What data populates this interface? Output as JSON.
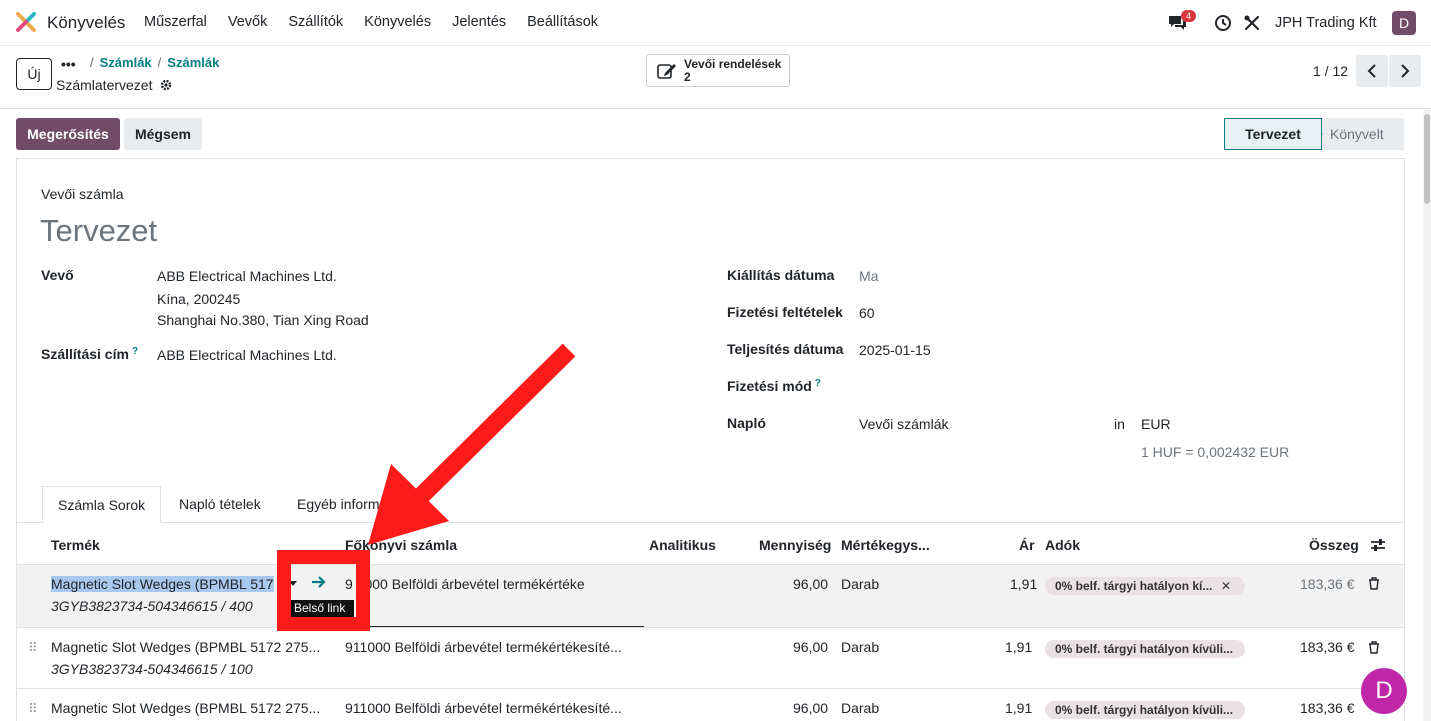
{
  "navbar": {
    "app_name": "Könyvelés",
    "menu": [
      "Műszerfal",
      "Vevők",
      "Szállítók",
      "Könyvelés",
      "Jelentés",
      "Beállítások"
    ],
    "chat_badge": "4",
    "company": "JPH Trading Kft",
    "user_initial": "D"
  },
  "control": {
    "new_label": "Új",
    "breadcrumb": [
      "Számlák",
      "Számlák"
    ],
    "record_title": "Számlatervezet",
    "smart_button": {
      "label": "Vevői rendelések",
      "count": "2"
    },
    "pager": "1 / 12"
  },
  "actions": {
    "confirm": "Megerősítés",
    "cancel": "Mégsem"
  },
  "statusbar": {
    "draft": "Tervezet",
    "posted": "Könyvelt"
  },
  "form": {
    "doc_type": "Vevői számla",
    "doc_name": "Tervezet",
    "customer_label": "Vevő",
    "customer_lines": [
      "ABB Electrical Machines Ltd.",
      "Kína, 200245",
      "Shanghai No.380, Tian Xing Road"
    ],
    "shipping_label": "Szállítási cím",
    "shipping_value": "ABB Electrical Machines Ltd.",
    "invoice_date_label": "Kiállítás dátuma",
    "invoice_date_value": "Ma",
    "payment_terms_label": "Fizetési feltételek",
    "payment_terms_value": "60",
    "delivery_date_label": "Teljesítés dátuma",
    "delivery_date_value": "2025-01-15",
    "payment_method_label": "Fizetési mód",
    "journal_label": "Napló",
    "journal_value": "Vevői számlák",
    "in_label": "in",
    "currency": "EUR",
    "rate": "1 HUF = 0,002432 EUR",
    "help_mark": "?"
  },
  "tabs": [
    "Számla Sorok",
    "Napló tételek",
    "Egyéb inform"
  ],
  "table": {
    "headers": {
      "product": "Termék",
      "account": "Főkönyvi számla",
      "analytic": "Analitikus",
      "quantity": "Mennyiség",
      "uom": "Mértékegys...",
      "price": "Ár",
      "taxes": "Adók",
      "subtotal": "Összeg"
    },
    "rows": [
      {
        "product": "Magnetic Slot Wedges (BPMBL 517",
        "ref": "3GYB3823734-504346615 / 400",
        "account": "9 1000 Belföldi árbevétel termékértéke",
        "quantity": "96,00",
        "uom": "Darab",
        "price": "1,91",
        "tax": "0% belf. tárgyi hatályon kí...",
        "subtotal": "183,36 €"
      },
      {
        "product": "Magnetic Slot Wedges (BPMBL 5172 275...",
        "ref": "3GYB3823734-504346615 / 100",
        "account": "911000 Belföldi árbevétel termékértékesíté...",
        "quantity": "96,00",
        "uom": "Darab",
        "price": "1,91",
        "tax": "0% belf. tárgyi hatályon kívüli...",
        "subtotal": "183,36 €"
      },
      {
        "product": "Magnetic Slot Wedges (BPMBL 5172 275...",
        "account": "911000 Belföldi árbevétel termékértékesíté...",
        "quantity": "96,00",
        "uom": "Darab",
        "price": "1,91",
        "tax": "0% belf. tárgyi hatályon kívüli...",
        "subtotal": "183,36 €"
      }
    ],
    "tooltip": "Belső link",
    "remove_tag": "✕"
  },
  "fab_initial": "D",
  "colors": {
    "brand": "#714b67",
    "teal": "#017e84",
    "annotation_red": "#ff1a1a",
    "fab": "#c026a8"
  }
}
